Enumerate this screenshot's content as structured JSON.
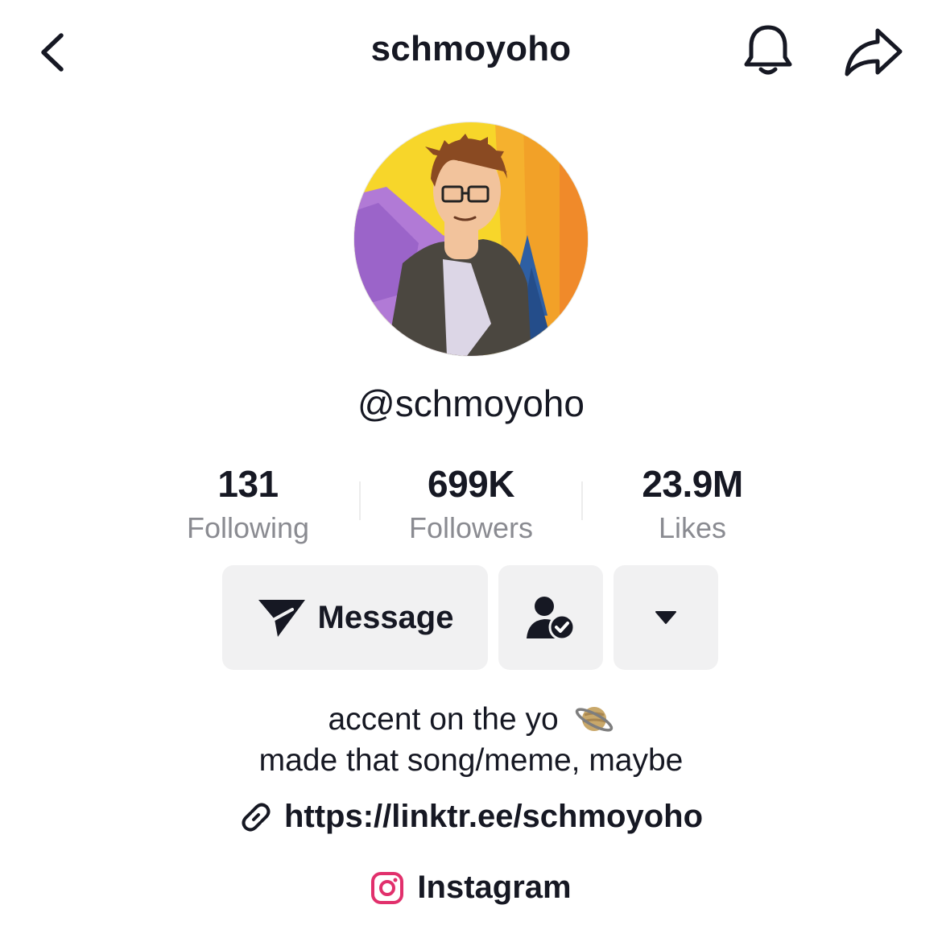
{
  "header": {
    "username": "schmoyoho",
    "back_icon": "chevron-left-icon",
    "bell_icon": "bell-icon",
    "share_icon": "share-arrow-icon"
  },
  "profile": {
    "handle": "@schmoyoho",
    "avatar": "cartoon-avatar"
  },
  "stats": [
    {
      "value": "131",
      "label": "Following"
    },
    {
      "value": "699K",
      "label": "Followers"
    },
    {
      "value": "23.9M",
      "label": "Likes"
    }
  ],
  "actions": {
    "message_label": "Message",
    "message_icon": "paper-plane-icon",
    "friends_icon": "person-check-icon",
    "more_icon": "caret-down-icon"
  },
  "bio": {
    "line1": "accent on the yo",
    "line1_emoji": "ringed-planet-emoji",
    "line2": "made that song/meme, maybe",
    "link": "https://linktr.ee/schmoyoho",
    "link_icon": "link-icon",
    "social_label": "Instagram",
    "social_icon": "instagram-icon"
  },
  "colors": {
    "text": "#161823",
    "secondary_text": "#8a8b91",
    "button_bg": "#f1f1f2",
    "instagram": "#e1306c"
  }
}
